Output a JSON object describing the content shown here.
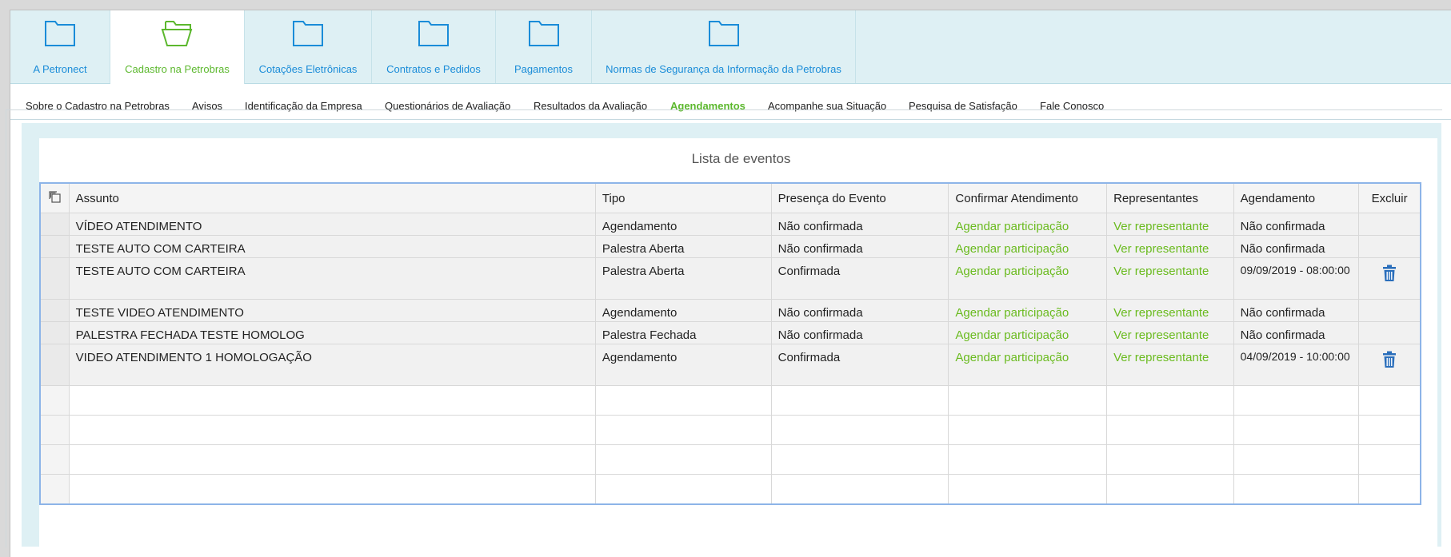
{
  "tabs": [
    {
      "label": "A Petronect"
    },
    {
      "label": "Cadastro na Petrobras"
    },
    {
      "label": "Cotações Eletrônicas"
    },
    {
      "label": "Contratos e Pedidos"
    },
    {
      "label": "Pagamentos"
    },
    {
      "label": "Normas de Segurança da Informação da Petrobras"
    }
  ],
  "submenu": [
    {
      "label": "Sobre o Cadastro na Petrobras"
    },
    {
      "label": "Avisos"
    },
    {
      "label": "Identificação da Empresa"
    },
    {
      "label": "Questionários de Avaliação"
    },
    {
      "label": "Resultados da Avaliação"
    },
    {
      "label": "Agendamentos"
    },
    {
      "label": "Acompanhe sua Situação"
    },
    {
      "label": "Pesquisa de Satisfação"
    },
    {
      "label": "Fale Conosco"
    }
  ],
  "list_title": "Lista de eventos",
  "columns": {
    "assunto": "Assunto",
    "tipo": "Tipo",
    "presenca": "Presença do Evento",
    "confirmar": "Confirmar Atendimento",
    "representantes": "Representantes",
    "agendamento": "Agendamento",
    "excluir": "Excluir"
  },
  "rows": [
    {
      "assunto": "VÍDEO ATENDIMENTO",
      "tipo": "Agendamento",
      "presenca": "Não confirmada",
      "confirmar": "Agendar participação",
      "representantes": "Ver representante",
      "agendamento": "Não confirmada"
    },
    {
      "assunto": "TESTE AUTO COM CARTEIRA",
      "tipo": "Palestra Aberta",
      "presenca": "Não confirmada",
      "confirmar": "Agendar participação",
      "representantes": "Ver representante",
      "agendamento": "Não confirmada"
    },
    {
      "assunto": "TESTE AUTO COM CARTEIRA",
      "tipo": "Palestra Aberta",
      "presenca": "Confirmada",
      "confirmar": "Agendar participação",
      "representantes": "Ver representante",
      "agendamento": "09/09/2019  -  08:00:00"
    },
    {
      "assunto": "TESTE VIDEO ATENDIMENTO",
      "tipo": "Agendamento",
      "presenca": "Não confirmada",
      "confirmar": "Agendar participação",
      "representantes": "Ver representante",
      "agendamento": "Não confirmada"
    },
    {
      "assunto": "PALESTRA FECHADA TESTE HOMOLOG",
      "tipo": "Palestra Fechada",
      "presenca": "Não confirmada",
      "confirmar": "Agendar participação",
      "representantes": "Ver representante",
      "agendamento": "Não confirmada"
    },
    {
      "assunto": "VIDEO ATENDIMENTO 1 HOMOLOGAÇÃO",
      "tipo": "Agendamento",
      "presenca": "Confirmada",
      "confirmar": "Agendar participação",
      "representantes": "Ver representante",
      "agendamento": "04/09/2019  -  10:00:00"
    }
  ],
  "colors": {
    "accent_green": "#5cb82e",
    "link_blue": "#1a8cd8",
    "trash_blue": "#2a6ebb"
  }
}
